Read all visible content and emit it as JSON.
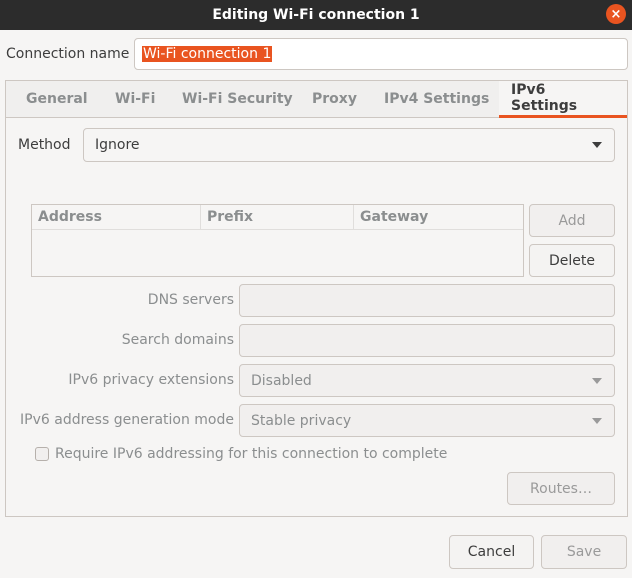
{
  "window": {
    "title": "Editing Wi-Fi connection 1",
    "close_glyph": "×"
  },
  "connection": {
    "label": "Connection name",
    "value": "Wi-Fi connection 1"
  },
  "tabs": [
    {
      "label": "General"
    },
    {
      "label": "Wi-Fi"
    },
    {
      "label": "Wi-Fi Security"
    },
    {
      "label": "Proxy"
    },
    {
      "label": "IPv4 Settings"
    },
    {
      "label": "IPv6 Settings"
    }
  ],
  "active_tab": "IPv6 Settings",
  "method": {
    "label": "Method",
    "value": "Ignore"
  },
  "addresses": {
    "columns": [
      "Address",
      "Prefix",
      "Gateway"
    ],
    "add_label": "Add",
    "delete_label": "Delete"
  },
  "dns": {
    "label": "DNS servers",
    "value": ""
  },
  "search_domains": {
    "label": "Search domains",
    "value": ""
  },
  "privacy": {
    "label": "IPv6 privacy extensions",
    "value": "Disabled"
  },
  "addr_gen": {
    "label": "IPv6 address generation mode",
    "value": "Stable privacy"
  },
  "require": {
    "label": "Require IPv6 addressing for this connection to complete",
    "checked": false
  },
  "routes_label": "Routes…",
  "footer": {
    "cancel_label": "Cancel",
    "save_label": "Save"
  },
  "colors": {
    "accent": "#e95420",
    "titlebar": "#2c2c2c",
    "background": "#f6f5f4"
  }
}
